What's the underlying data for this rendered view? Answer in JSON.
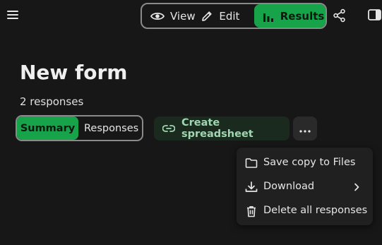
{
  "header": {
    "menu_icon": "hamburger-menu-icon",
    "view_modes": [
      {
        "label": "View",
        "icon": "eye-icon",
        "active": false
      },
      {
        "label": "Edit",
        "icon": "pencil-icon",
        "active": false
      },
      {
        "label": "Results",
        "icon": "bar-chart-icon",
        "active": true
      }
    ],
    "share_icon": "share-icon",
    "panel_icon": "side-panel-icon"
  },
  "main": {
    "title": "New form",
    "response_count": "2 responses",
    "tabs": [
      {
        "label": "Summary",
        "active": true
      },
      {
        "label": "Responses",
        "active": false
      }
    ],
    "create_spreadsheet_label": "Create spreadsheet",
    "more_icon": "more-horizontal-icon"
  },
  "dropdown_menu": {
    "items": [
      {
        "label": "Save copy to Files",
        "icon": "folder-icon"
      },
      {
        "label": "Download",
        "icon": "download-icon",
        "submenu": true
      },
      {
        "label": "Delete all responses",
        "icon": "trash-icon"
      }
    ]
  },
  "colors": {
    "background": "#171717",
    "accent_green": "#16a34a",
    "create_button_bg": "#1b2a1f",
    "create_button_text": "#9fd8b0",
    "menu_bg": "#202020"
  }
}
